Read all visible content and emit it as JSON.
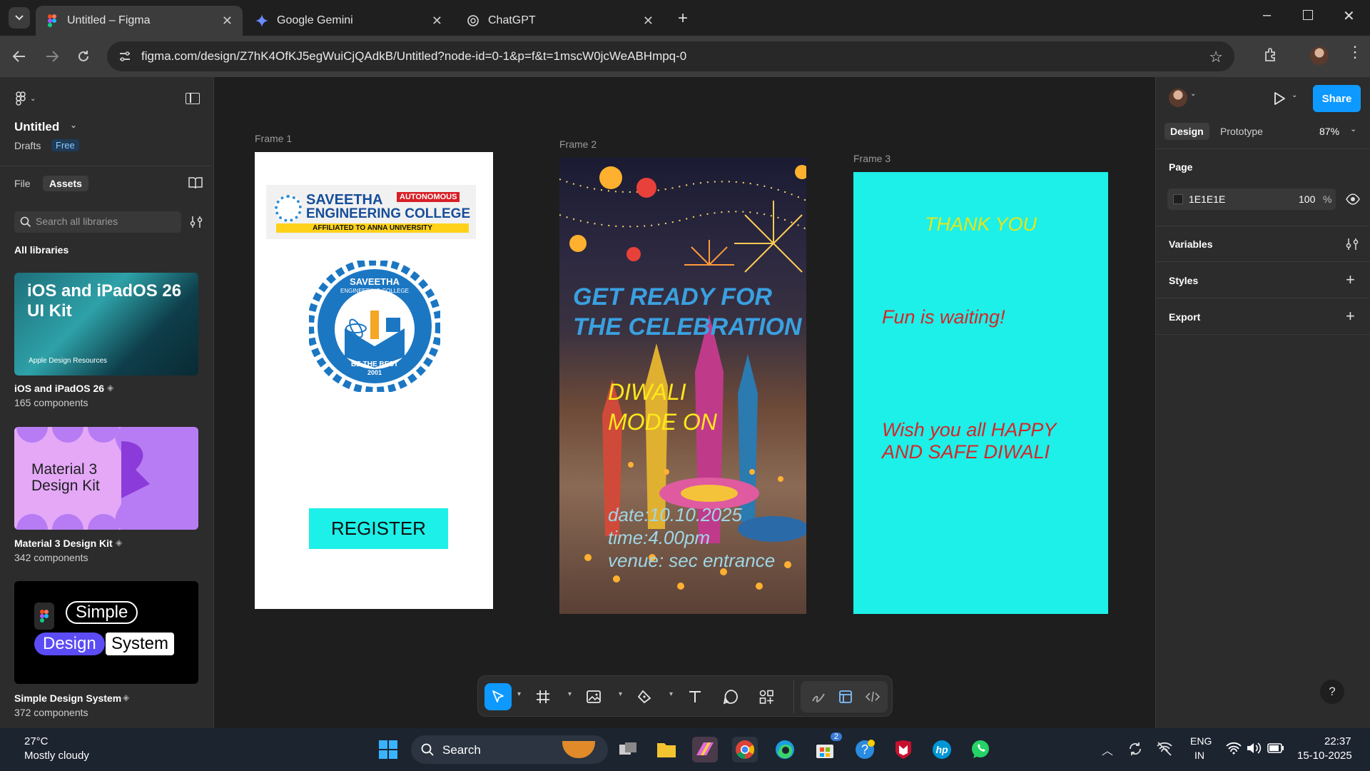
{
  "browser": {
    "tabs": [
      {
        "title": "Untitled – Figma",
        "icon": "figma-icon",
        "active": true
      },
      {
        "title": "Google Gemini",
        "icon": "gemini-icon",
        "active": false
      },
      {
        "title": "ChatGPT",
        "icon": "chatgpt-icon",
        "active": false
      }
    ],
    "url": "figma.com/design/Z7hK4OfKJ5egWuiCjQAdkB/Untitled?node-id=0-1&p=f&t=1mscW0jcWeABHmpq-0"
  },
  "left_panel": {
    "file_name": "Untitled",
    "drafts_label": "Drafts",
    "plan_badge": "Free",
    "tabs": [
      "File",
      "Assets"
    ],
    "search_placeholder": "Search all libraries",
    "section_title": "All libraries",
    "libraries": [
      {
        "name": "iOS and iPadOS 26",
        "count": "165 components",
        "thumb_title": "iOS and iPadOS 26 UI Kit",
        "thumb_caption": "Apple Design Resources"
      },
      {
        "name": "Material 3 Design Kit",
        "count": "342 components",
        "thumb_title": "Material 3 Design Kit"
      },
      {
        "name": "Simple Design System",
        "count": "372 components",
        "thumb_words": [
          "Simple",
          "Design",
          "System"
        ]
      }
    ]
  },
  "canvas": {
    "frame1": {
      "label": "Frame 1",
      "college_name": "SAVEETHA ENGINEERING COLLEGE",
      "college_line1": "SAVEETHA",
      "college_line2": "ENGINEERING COLLEGE",
      "autonomous_tag": "AUTONOMOUS",
      "affiliation": "AFFILIATED TO ANNA UNIVERSITY",
      "emblem_top": "SAVEETHA",
      "emblem_sub": "ENGINEERING COLLEGE",
      "emblem_motto": "BE THE BEST",
      "emblem_year": "2001",
      "button": "REGISTER"
    },
    "frame2": {
      "label": "Frame 2",
      "headline": [
        "GET READY FOR",
        "THE CELEBRATION"
      ],
      "subhead": [
        "DIWALI",
        "MODE ON"
      ],
      "details": [
        "date:10.10.2025",
        "time:4.00pm",
        "venue: sec entrance"
      ]
    },
    "frame3": {
      "label": "Frame 3",
      "title": "THANK YOU",
      "line1": "Fun is waiting!",
      "line2a": "Wish you all HAPPY",
      "line2b": "AND SAFE  DIWALI"
    }
  },
  "right_panel": {
    "tabs": [
      "Design",
      "Prototype"
    ],
    "zoom": "87%",
    "share_label": "Share",
    "page_section": "Page",
    "page_color": "1E1E1E",
    "page_opacity": "100",
    "percent": "%",
    "sections": [
      "Variables",
      "Styles",
      "Export"
    ]
  },
  "taskbar": {
    "weather_temp": "27°C",
    "weather_desc": "Mostly cloudy",
    "search_label": "Search",
    "lang1": "ENG",
    "lang2": "IN",
    "time": "22:37",
    "date": "15-10-2025",
    "store_badge": "2"
  },
  "colors": {
    "figma_blue": "#0d99ff",
    "frame2_headline": "#3aa0e0",
    "frame2_subhead": "#ffe81a",
    "frame3_bg": "#1cf0e8",
    "frame3_title": "#e6e61a",
    "frame3_text": "#d6262a",
    "register_bg": "#1cf0e8"
  }
}
